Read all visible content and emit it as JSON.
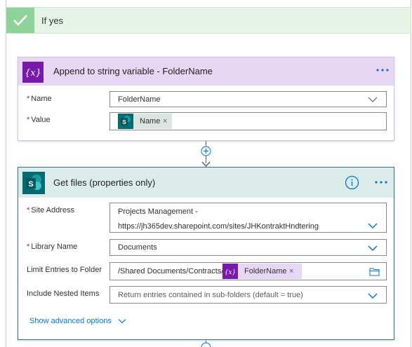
{
  "if_yes": {
    "title": "If yes"
  },
  "append_card": {
    "title": "Append to string variable - FolderName",
    "icon_text": "{x}",
    "name_label": "Name",
    "name_value": "FolderName",
    "value_label": "Value",
    "value_token": "Name",
    "token_remove": "×",
    "accent": "#e8d6f5",
    "icon_bg": "#7719aa"
  },
  "get_files_card": {
    "title": "Get files (properties only)",
    "site_address_label": "Site Address",
    "site_address_line1": "Projects Management -",
    "site_address_line2": "https://jh365dev.sharepoint.com/sites/JHKontraktHndtering",
    "library_label": "Library Name",
    "library_value": "Documents",
    "limit_label": "Limit Entries to Folder",
    "limit_path": "/Shared Documents/Contracts/",
    "limit_token": "FolderName",
    "token_remove": "×",
    "nested_label": "Include Nested Items",
    "nested_placeholder": "Return entries contained in sub-folders (default = true)",
    "advanced_link": "Show advanced options",
    "accent": "#dceceb",
    "icon_bg": "#036c70",
    "icon_letter": "S"
  },
  "required_marker": "*",
  "icons": [
    "check-icon",
    "variable-icon",
    "more-icon",
    "chevron-down-icon",
    "sharepoint-icon",
    "info-icon",
    "folder-icon",
    "add-icon",
    "arrow-down-icon"
  ]
}
